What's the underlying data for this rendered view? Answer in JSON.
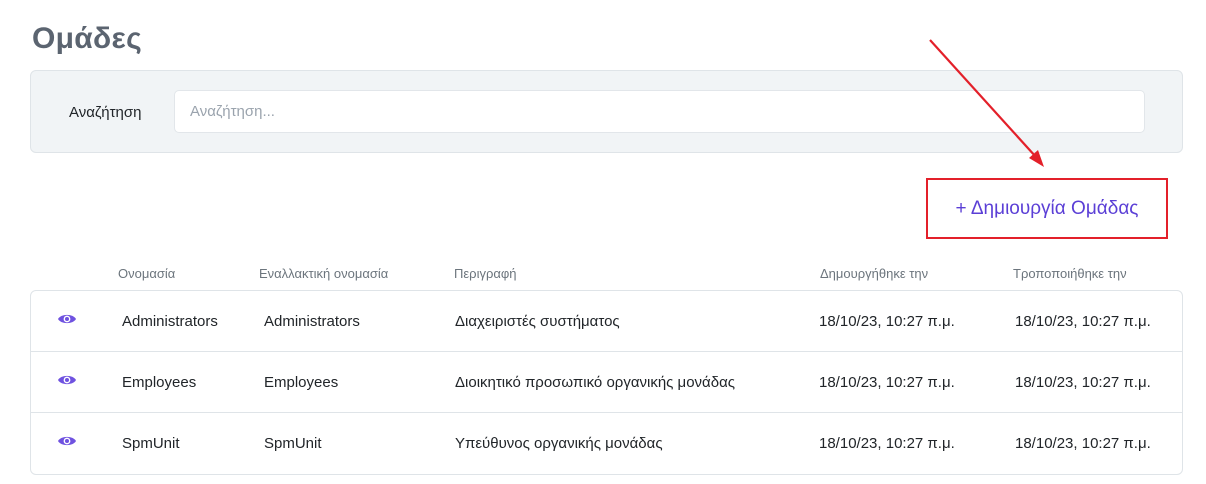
{
  "page": {
    "title": "Ομάδες"
  },
  "search": {
    "label": "Αναζήτηση",
    "placeholder": "Αναζήτηση...",
    "value": ""
  },
  "actions": {
    "create_label": "+ Δημιουργία Ομάδας"
  },
  "table": {
    "columns": [
      "Ονομασία",
      "Εναλλακτική ονομασία",
      "Περιγραφή",
      "Δημουργήθηκε την",
      "Τροποποιήθηκε την"
    ],
    "rows": [
      {
        "name": "Administrators",
        "alt_name": "Administrators",
        "description": "Διαχειριστές συστήματος",
        "created": "18/10/23, 10:27 π.μ.",
        "modified": "18/10/23, 10:27 π.μ."
      },
      {
        "name": "Employees",
        "alt_name": "Employees",
        "description": "Διοικητικό προσωπικό οργανικής μονάδας",
        "created": "18/10/23, 10:27 π.μ.",
        "modified": "18/10/23, 10:27 π.μ."
      },
      {
        "name": "SpmUnit",
        "alt_name": "SpmUnit",
        "description": "Υπεύθυνος οργανικής μονάδας",
        "created": "18/10/23, 10:27 π.μ.",
        "modified": "18/10/23, 10:27 π.μ."
      }
    ]
  },
  "icons": {
    "view": "eye-icon"
  },
  "colors": {
    "accent": "#5b3fd6",
    "highlight": "#e3202a",
    "title": "#5b6470"
  }
}
